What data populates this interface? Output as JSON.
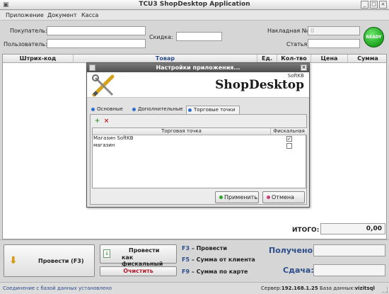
{
  "window": {
    "title": "ТСU3 ShopDesktop Application",
    "btn_min": "_",
    "btn_max": "□",
    "btn_close": "×"
  },
  "menu": [
    "Приложение",
    "Документ",
    "Касса"
  ],
  "form": {
    "buyer_label": "Покупатель:",
    "user_label": "Пользователь:",
    "discount_label": "Скидка:",
    "invoice_label": "Накладная №:",
    "invoice_value": "0",
    "article_label": "Статья:",
    "ready": "READY"
  },
  "grid": {
    "columns": [
      "Штрих-код",
      "Товар",
      "Ед.",
      "Кол-тво",
      "Цена",
      "Сумма"
    ]
  },
  "totals": {
    "label": "ИТОГО:",
    "value": "0,00"
  },
  "actions": {
    "post_f3": "Провести (F3)",
    "post_fiscal_line1": "Провести",
    "post_fiscal_line2": "как фискальный",
    "clear": "Очистить"
  },
  "shortcuts": [
    {
      "key": "F3",
      "text": " – Провести"
    },
    {
      "key": "F5",
      "text": " – Сумма от клиента"
    },
    {
      "key": "F9",
      "text": " – Сумма по карте"
    }
  ],
  "payment": {
    "received_label": "Получено:",
    "change_label": "Сдача:"
  },
  "status": {
    "left": "Соединение с базой данных установлено",
    "server_label": "Сервер:",
    "server_value": "192.168.1.25",
    "db_label": "База данных:",
    "db_value": "vizitsql"
  },
  "dialog": {
    "title": "Настройки приложения...",
    "brand": "ShopDesktop",
    "brand_sub": "SoftKB",
    "close": "×",
    "tabs": [
      "Основные",
      "Дополнительные",
      "Торговые точки"
    ],
    "active_tab": "Торговые точки",
    "add_icon": "+",
    "remove_icon": "×",
    "table": {
      "columns": [
        "Торговая точка",
        "Фискальная"
      ],
      "rows": [
        {
          "name": "Магазин SoftKB",
          "fiscal": true,
          "mark": "✓"
        },
        {
          "name": "магазин",
          "fiscal": false,
          "mark": ""
        }
      ]
    },
    "apply": "Применить",
    "cancel": "Отмена",
    "colors": {
      "apply_dot": "#2aa62a",
      "cancel_dot": "#d23a7a",
      "tab_dot": "#2f6fd0"
    }
  }
}
